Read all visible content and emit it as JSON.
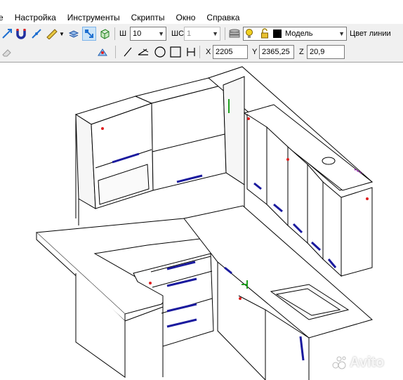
{
  "menu": [
    "е",
    "Настройка",
    "Инструменты",
    "Скрипты",
    "Окно",
    "Справка"
  ],
  "toolbar": {
    "width_label": "Ш",
    "width_value": "10",
    "shc_label": "ШС",
    "shc_value": "1",
    "layer_value": "Модель",
    "line_color_label": "Цвет линии"
  },
  "coords": {
    "x_label": "X",
    "x_value": "2205",
    "y_label": "Y",
    "y_value": "2365,25",
    "z_label": "Z",
    "z_value": "20,9"
  },
  "watermark": "Avito",
  "colors": {
    "accent": "#1e90ff",
    "handle": "#1a1a9e",
    "marker_red": "#e02020",
    "marker_green": "#20a020",
    "layer_swatch": "#000000"
  }
}
